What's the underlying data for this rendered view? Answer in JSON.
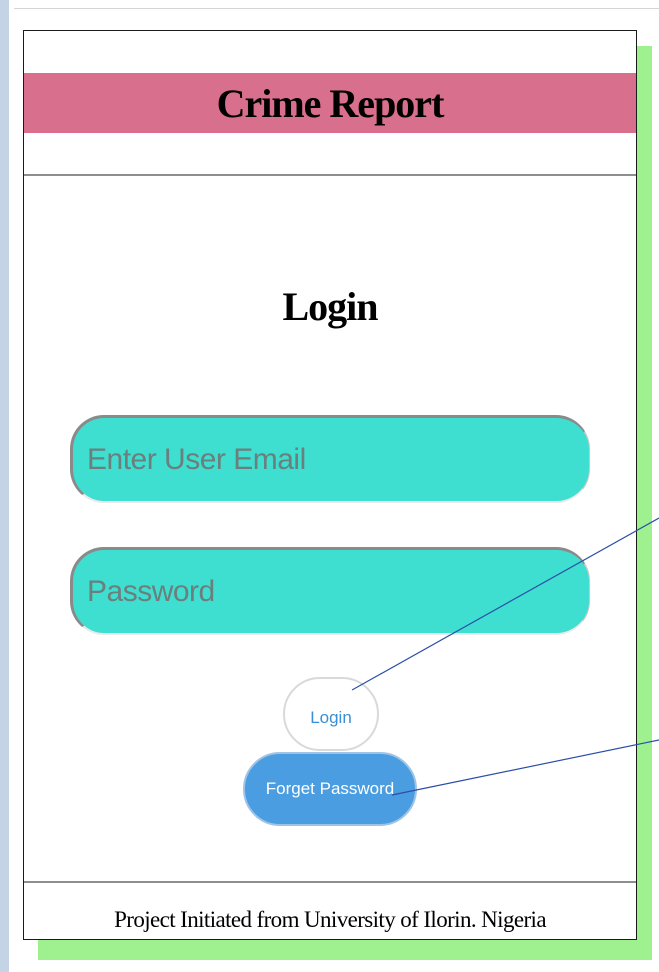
{
  "app": {
    "title": "Crime Report"
  },
  "login": {
    "heading": "Login",
    "email_placeholder": "Enter User Email",
    "password_placeholder": "Password",
    "login_button": "Login",
    "forgot_button": "Forget Password"
  },
  "footer": {
    "text": "Project Initiated from University of Ilorin. Nigeria"
  },
  "colors": {
    "banner": "#d86f8d",
    "input_fill": "#3edfd0",
    "primary_button": "#4a9de0",
    "shadow": "#9ff08f",
    "callout_line": "#2b4fa8"
  }
}
